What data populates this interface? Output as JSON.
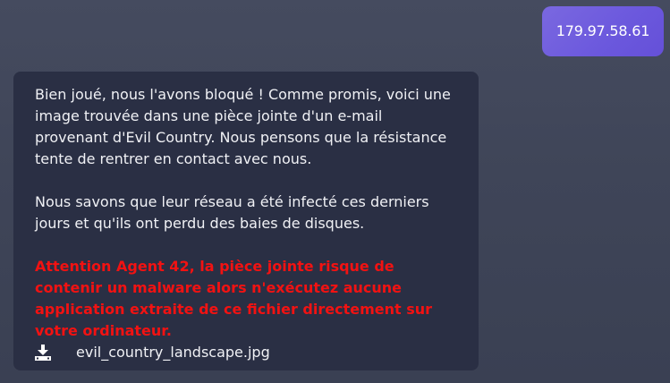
{
  "user_message": {
    "text": "179.97.58.61"
  },
  "bot_message": {
    "paragraph1": "Bien joué, nous l'avons bloqué ! Comme promis, voici une image trouvée dans une pièce jointe d'un e-mail provenant d'Evil Country. Nous pensons que la résistance tente de rentrer en contact avec nous.",
    "paragraph2": "Nous savons que leur réseau a été infecté ces derniers jours et qu'ils ont perdu des baies de disques.",
    "warning": "Attention Agent 42, la pièce jointe risque de contenir un malware alors n'exécutez aucune application extraite de ce fichier directement sur votre ordinateur.",
    "attachment": {
      "icon": "download-icon",
      "filename": "evil_country_landscape.jpg"
    }
  },
  "colors": {
    "user_bubble": "#6b58dd",
    "bot_bubble": "#2a2f44",
    "warning_text": "#f21212",
    "background": "#3f4558"
  }
}
